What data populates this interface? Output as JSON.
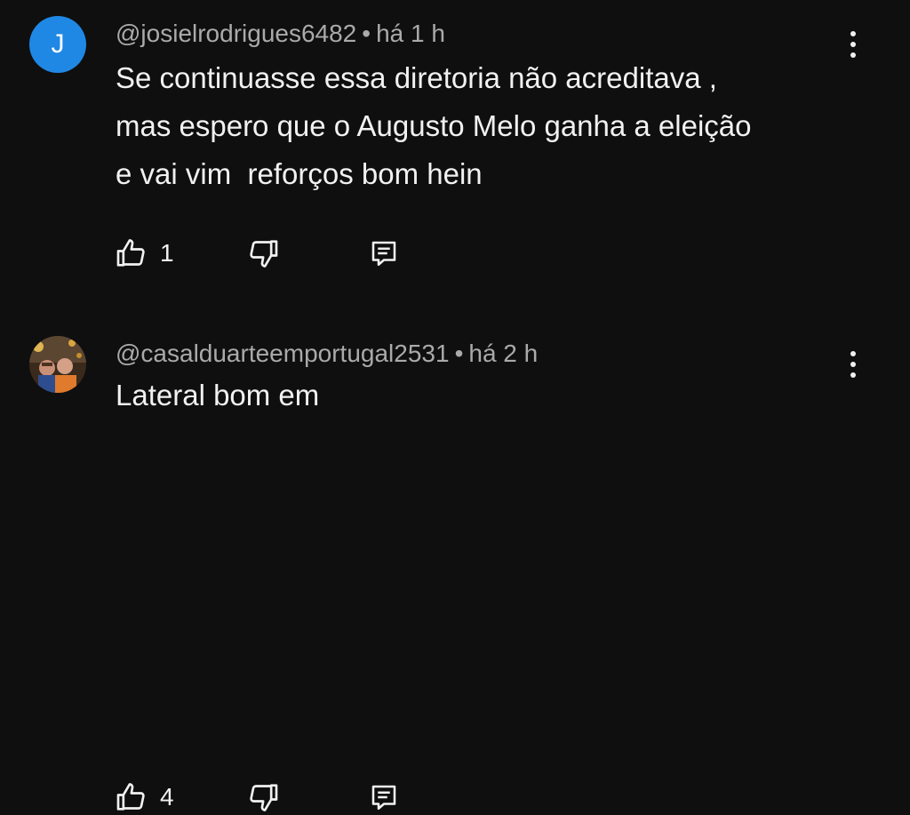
{
  "comments": [
    {
      "avatar_letter": "J",
      "avatar_color": "#1f88e5",
      "username": "@josielrodrigues6482",
      "separator": "•",
      "time": "há 1 h",
      "lines": [
        "Se continuasse essa diretoria não acreditava ,",
        "mas espero que o Augusto Melo ganha a eleição",
        "e vai vim  reforços bom hein"
      ],
      "likes": "1",
      "icons": [
        "thumbs-up-icon",
        "thumbs-down-icon",
        "reply-icon",
        "more-vert-icon"
      ]
    },
    {
      "avatar_kind": "photo",
      "username": "@casalduarteemportugal2531",
      "separator": "•",
      "time": "há 2 h",
      "lines": [
        "Lateral bom em"
      ],
      "likes": "4",
      "icons": [
        "thumbs-up-icon",
        "thumbs-down-icon",
        "reply-icon",
        "more-vert-icon"
      ]
    }
  ],
  "colors": {
    "background": "#0f0f0f",
    "text_primary": "#f1f1f1",
    "text_secondary": "#aaaaaa"
  }
}
